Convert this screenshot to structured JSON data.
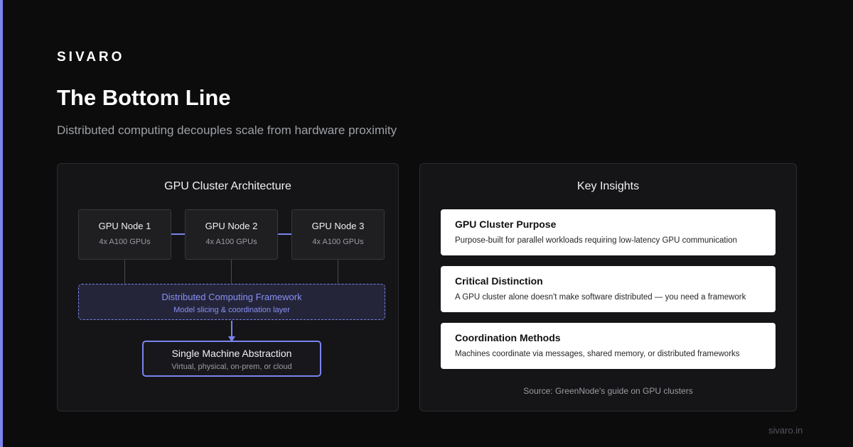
{
  "brand": "SIVARO",
  "title": "The Bottom Line",
  "subtitle": "Distributed computing decouples scale from hardware proximity",
  "colors": {
    "accent": "#7b83ee",
    "background": "#0c0c0d",
    "panel": "#151517"
  },
  "architecture": {
    "title": "GPU Cluster Architecture",
    "nodes": [
      {
        "name": "GPU Node 1",
        "spec": "4x A100 GPUs"
      },
      {
        "name": "GPU Node 2",
        "spec": "4x A100 GPUs"
      },
      {
        "name": "GPU Node 3",
        "spec": "4x A100 GPUs"
      }
    ],
    "framework": {
      "title": "Distributed Computing Framework",
      "subtitle": "Model slicing & coordination layer"
    },
    "abstraction": {
      "title": "Single Machine Abstraction",
      "subtitle": "Virtual, physical, on-prem, or cloud"
    }
  },
  "insights": {
    "title": "Key Insights",
    "cards": [
      {
        "title": "GPU Cluster Purpose",
        "text": "Purpose-built for parallel workloads requiring low-latency GPU communication"
      },
      {
        "title": "Critical Distinction",
        "text": "A GPU cluster alone doesn't make software distributed — you need a framework"
      },
      {
        "title": "Coordination Methods",
        "text": "Machines coordinate via messages, shared memory, or distributed frameworks"
      }
    ],
    "source": "Source: GreenNode's guide on GPU clusters"
  },
  "footer_url": "sivaro.in"
}
